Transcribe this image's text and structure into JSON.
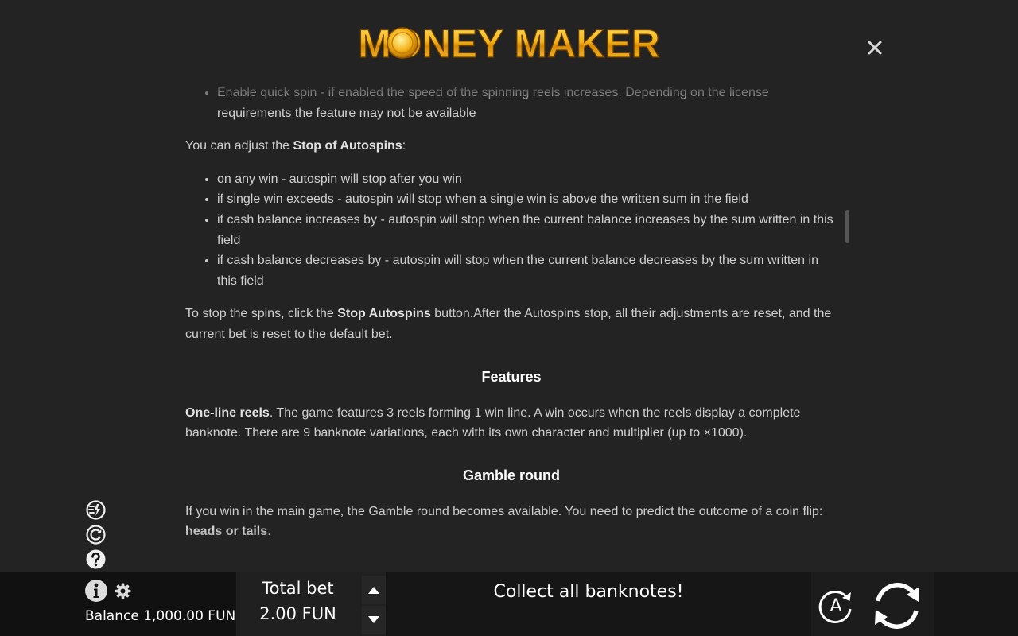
{
  "header": {
    "logo_text": "MONEY MAKER",
    "close_label": "×"
  },
  "content": {
    "quick_spin_item": "Enable quick spin - if enabled the speed of the spinning reels increases. Depending on the license requirements the feature may not be available",
    "stop_intro_prefix": "You can adjust the ",
    "stop_intro_bold": "Stop of Autospins",
    "stop_intro_suffix": ":",
    "stop_items": [
      "on any win - autospin will stop after you win",
      "if single win exceeds - autospin will stop when a single win is above the written sum in the field",
      "if cash balance increases by - autospin will stop when the current balance increases by the sum written in this field",
      "if cash balance decreases by - autospin will stop when the current balance decreases by the sum written in this field"
    ],
    "stop_spins_prefix": "To stop the spins, click the ",
    "stop_spins_bold": "Stop Autospins",
    "stop_spins_suffix": " button.After the Autospins stop, all their adjustments are reset, and the current bet is reset to the default bet.",
    "features_heading": "Features",
    "one_line_bold": "One-line reels",
    "one_line_text": ". The game features 3 reels forming 1 win line. A win occurs when the reels display a complete banknote. There are 9 banknote variations, each with its own character and multiplier (up to ×1000).",
    "gamble_heading": "Gamble round",
    "gamble_text": "If you win in the main game, the Gamble round becomes available. You need to predict the outcome of a coin flip: ",
    "gamble_bold": "heads or tails",
    "gamble_suffix": "."
  },
  "side_icons": [
    "turbo-icon",
    "autoplay-icon",
    "help-icon"
  ],
  "bottom_bar": {
    "balance_text": "Balance 1,000.00 FUN",
    "total_bet_label": "Total bet",
    "total_bet_value": "2.00 FUN",
    "message": "Collect all banknotes!",
    "auto_label": "A"
  },
  "colors": {
    "background": "#232323",
    "bar": "#161616",
    "logo_gold": "#f2b81c",
    "text": "#cfcfcf"
  }
}
